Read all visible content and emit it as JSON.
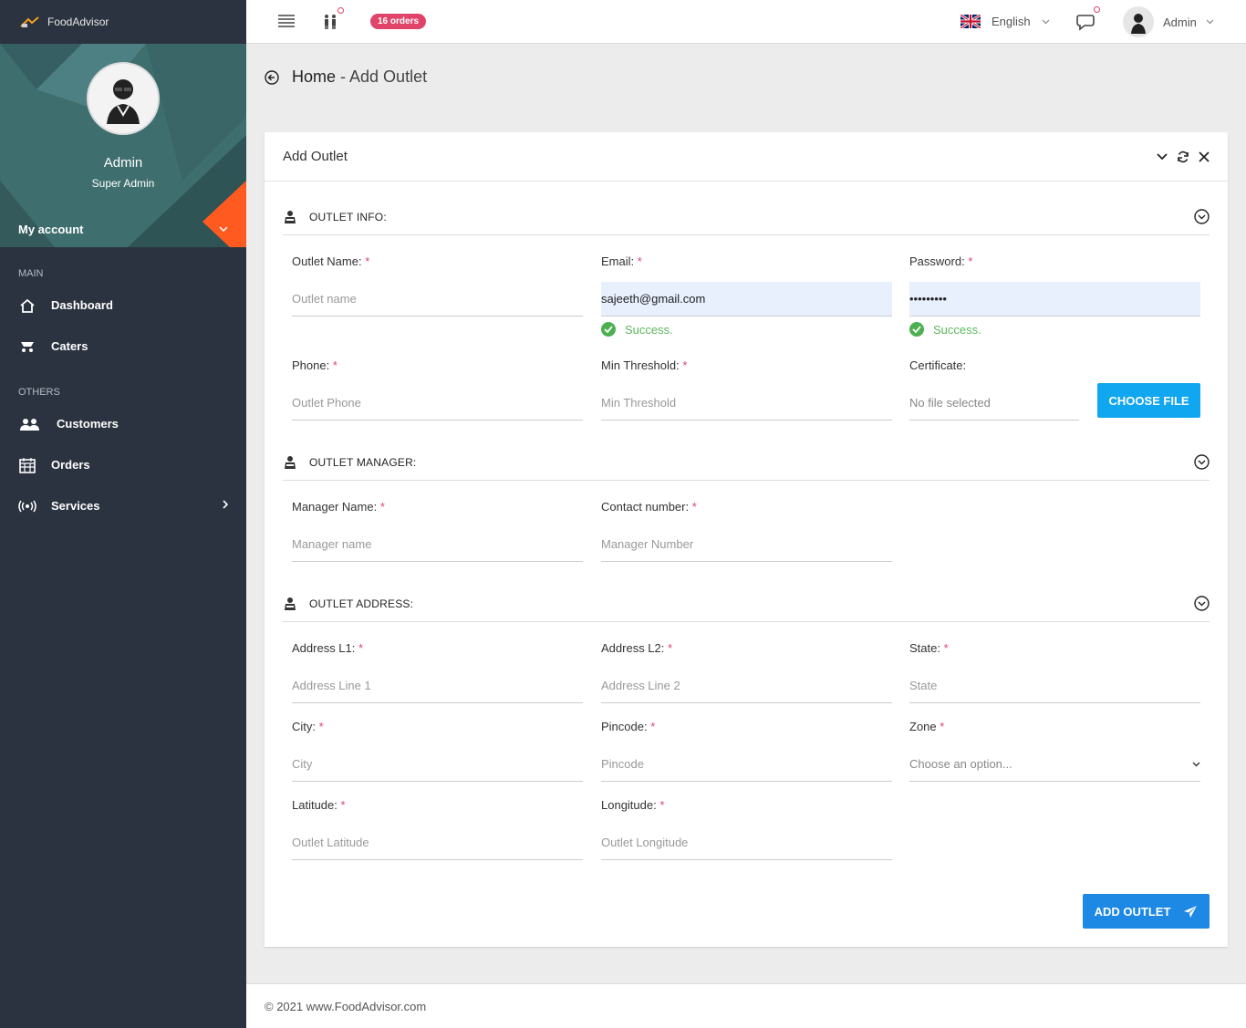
{
  "brand": {
    "name": "FoodAdvisor"
  },
  "profile": {
    "name": "Admin",
    "role": "Super Admin",
    "account_label": "My account"
  },
  "sidebar": {
    "sections": [
      {
        "title": "MAIN",
        "items": [
          {
            "label": "Dashboard",
            "icon": "home-icon"
          },
          {
            "label": "Caters",
            "icon": "caters-icon"
          }
        ]
      },
      {
        "title": "OTHERS",
        "items": [
          {
            "label": "Customers",
            "icon": "users-icon"
          },
          {
            "label": "Orders",
            "icon": "calendar-icon"
          },
          {
            "label": "Services",
            "icon": "broadcast-icon"
          }
        ]
      }
    ]
  },
  "topbar": {
    "orders_badge": "16 orders",
    "language": "English",
    "user": "Admin"
  },
  "page": {
    "crumb_home": "Home",
    "crumb_sep": " - ",
    "crumb_current": "Add Outlet"
  },
  "card": {
    "title": "Add Outlet"
  },
  "sections": {
    "outlet_info": "OUTLET INFO:",
    "outlet_manager": "OUTLET MANAGER:",
    "outlet_address": "OUTLET ADDRESS:"
  },
  "fields": {
    "outlet_name": {
      "label": "Outlet Name:",
      "placeholder": "Outlet name"
    },
    "email": {
      "label": "Email:",
      "value": "sajeeth@gmail.com"
    },
    "password": {
      "label": "Password:",
      "value": "•••••••••"
    },
    "phone": {
      "label": "Phone:",
      "placeholder": "Outlet Phone"
    },
    "min_threshold": {
      "label": "Min Threshold:",
      "placeholder": "Min Threshold"
    },
    "certificate": {
      "label": "Certificate:",
      "placeholder": "No file selected",
      "button": "CHOOSE FILE"
    },
    "manager_name": {
      "label": "Manager Name:",
      "placeholder": "Manager name"
    },
    "contact_number": {
      "label": "Contact number:",
      "placeholder": "Manager Number"
    },
    "address1": {
      "label": "Address L1:",
      "placeholder": "Address Line 1"
    },
    "address2": {
      "label": "Address L2:",
      "placeholder": "Address Line 2"
    },
    "state": {
      "label": "State:",
      "placeholder": "State"
    },
    "city": {
      "label": "City:",
      "placeholder": "City"
    },
    "pincode": {
      "label": "Pincode:",
      "placeholder": "Pincode"
    },
    "zone": {
      "label": "Zone",
      "placeholder": "Choose an option..."
    },
    "latitude": {
      "label": "Latitude:",
      "placeholder": "Outlet Latitude"
    },
    "longitude": {
      "label": "Longitude:",
      "placeholder": "Outlet Longitude"
    }
  },
  "status": {
    "success": "Success."
  },
  "required_mark": "*",
  "actions": {
    "add_outlet": "ADD OUTLET"
  },
  "footer": {
    "text": "© 2021 www.FoodAdvisor.com"
  },
  "colors": {
    "sidebar": "#2b3340",
    "accent": "#1e88e5",
    "badge": "#e0446b",
    "success": "#4caf50",
    "profile_bg": "#3f6e6f",
    "orange": "#ff5a1f"
  }
}
